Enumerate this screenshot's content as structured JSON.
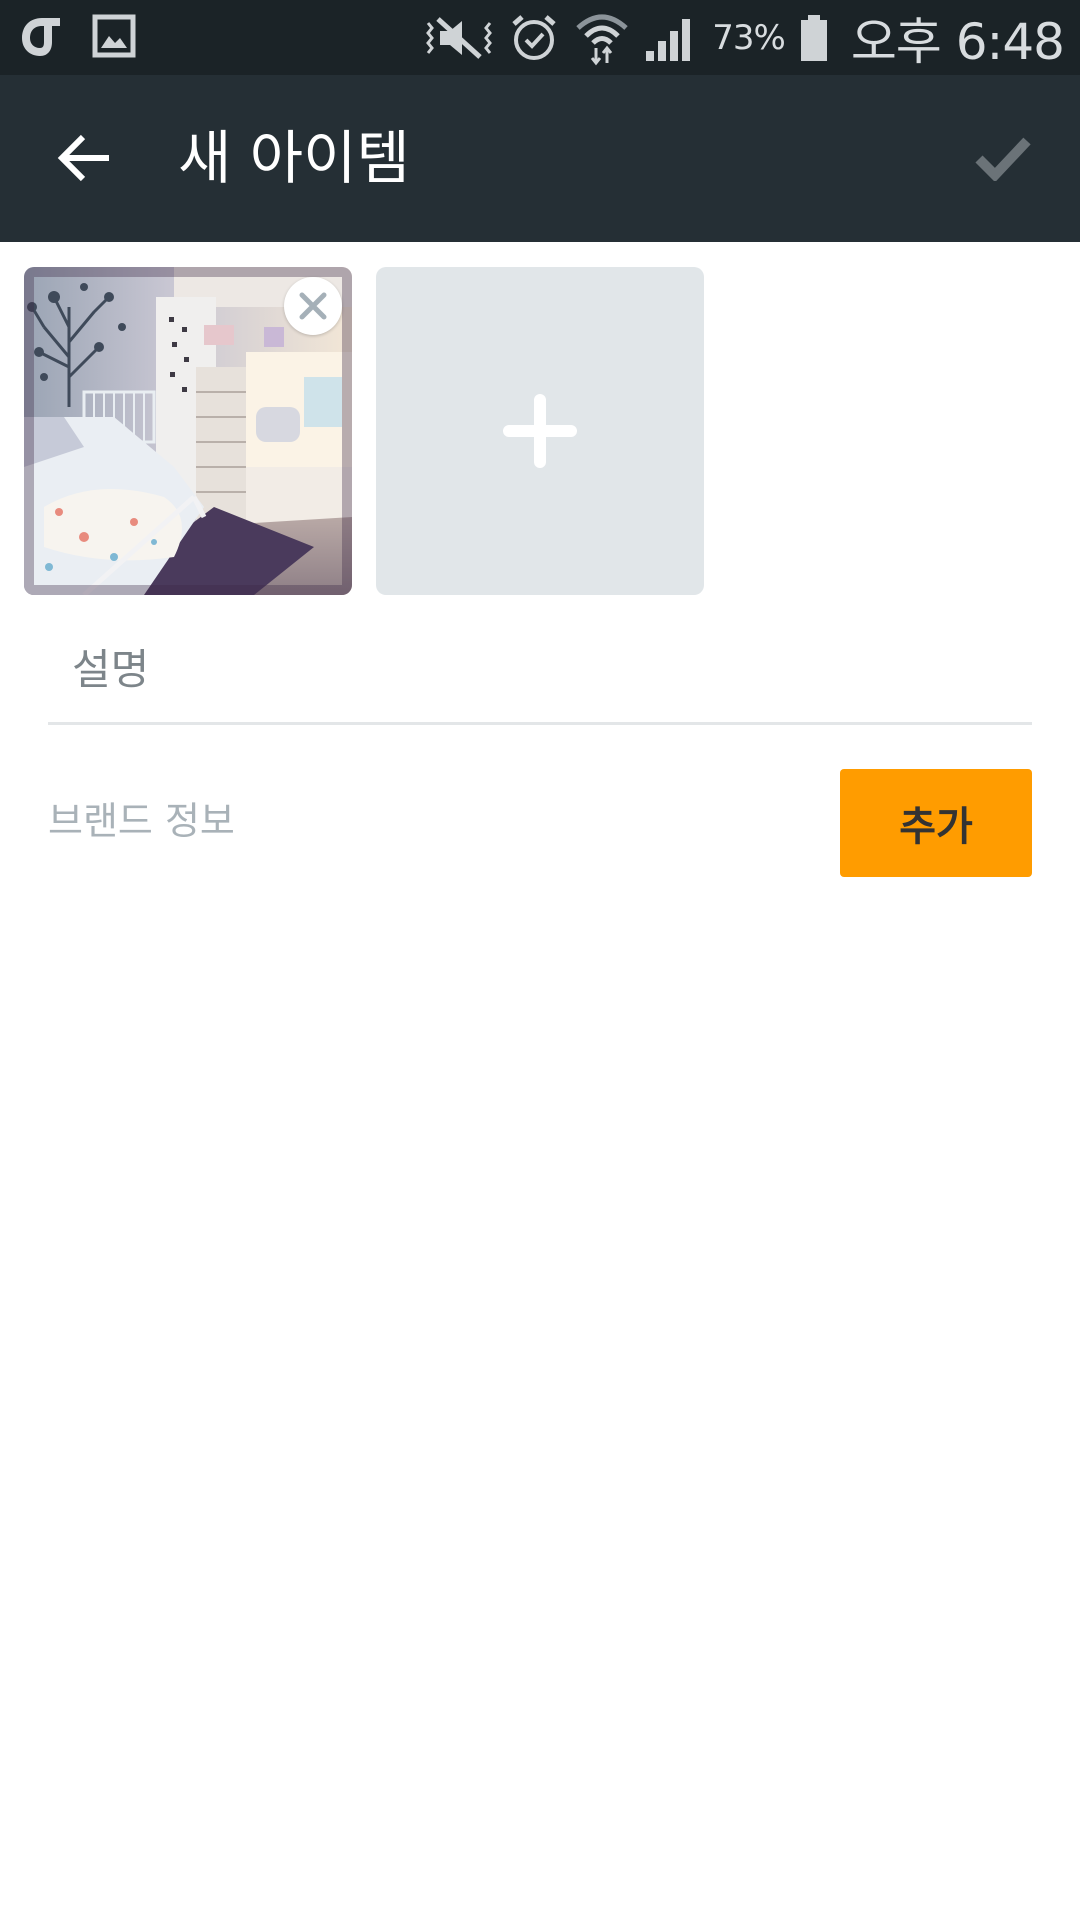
{
  "status_bar": {
    "battery_percent": "73%",
    "time": "오후 6:48",
    "icons": [
      "app-notification-icon",
      "gallery-icon",
      "vibrate-mute-icon",
      "alarm-icon",
      "wifi-icon",
      "signal-icon",
      "battery-icon"
    ]
  },
  "app_bar": {
    "title": "새 아이템",
    "back_icon": "arrow-back-icon",
    "confirm_icon": "check-icon"
  },
  "photos": {
    "items": [
      {
        "description": "bedroom photo thumbnail",
        "remove_icon": "close-icon"
      }
    ],
    "add_icon": "plus-icon"
  },
  "description": {
    "label": "설명"
  },
  "brand": {
    "placeholder": "브랜드 정보",
    "add_label": "추가"
  },
  "colors": {
    "status_bar": "#1b2327",
    "app_bar": "#252f35",
    "accent": "#ff9c00",
    "add_tile": "#e1e6e9"
  }
}
